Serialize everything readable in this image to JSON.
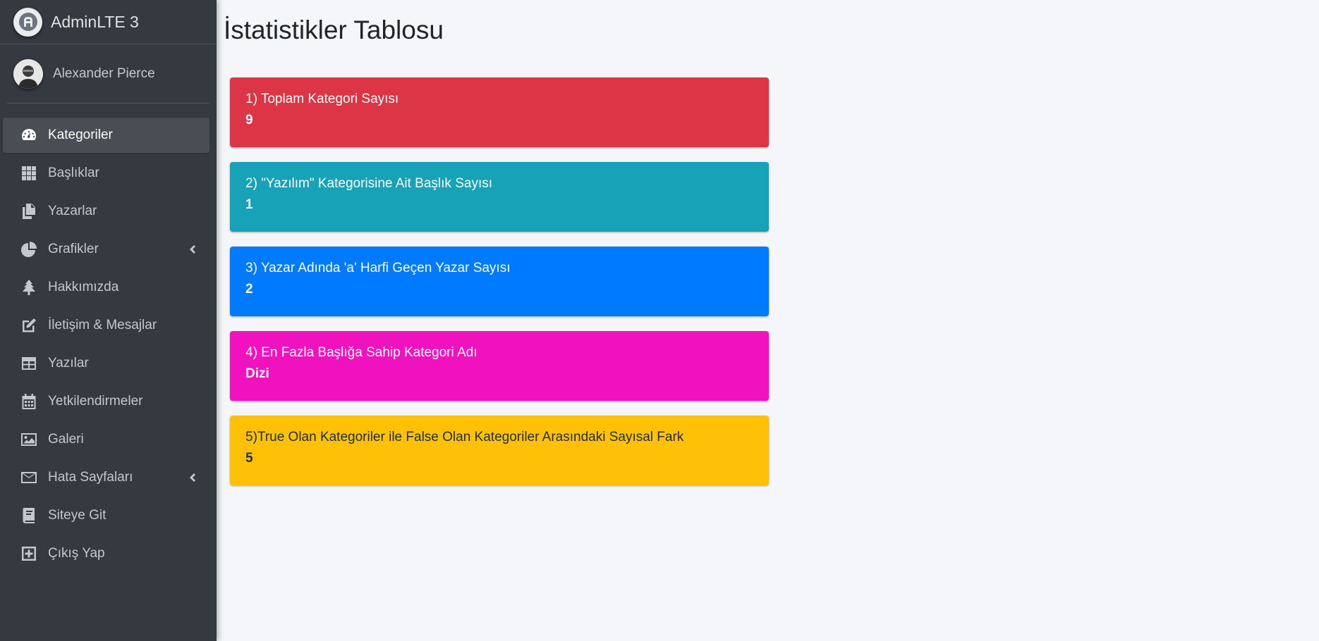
{
  "brand": {
    "title": "AdminLTE 3"
  },
  "user": {
    "name": "Alexander Pierce"
  },
  "sidebar": {
    "items": [
      {
        "label": "Kategoriler",
        "icon": "tachometer-icon",
        "active": true
      },
      {
        "label": "Başlıklar",
        "icon": "grid-icon"
      },
      {
        "label": "Yazarlar",
        "icon": "copy-icon"
      },
      {
        "label": "Grafikler",
        "icon": "chart-pie-icon",
        "has_arrow": true
      },
      {
        "label": "Hakkımızda",
        "icon": "tree-icon"
      },
      {
        "label": "İletişim & Mesajlar",
        "icon": "edit-icon"
      },
      {
        "label": "Yazılar",
        "icon": "table-icon"
      },
      {
        "label": "Yetkilendirmeler",
        "icon": "calendar-icon"
      },
      {
        "label": "Galeri",
        "icon": "image-icon"
      },
      {
        "label": "Hata Sayfaları",
        "icon": "envelope-icon",
        "has_arrow": true
      },
      {
        "label": "Siteye Git",
        "icon": "book-icon"
      },
      {
        "label": "Çıkış Yap",
        "icon": "plus-square-icon"
      }
    ]
  },
  "main": {
    "title": "İstatistikler Tablosu",
    "stats": [
      {
        "title": "1) Toplam Kategori Sayısı",
        "value": "9",
        "color": "#dc3545"
      },
      {
        "title": "2) \"Yazılım\" Kategorisine Ait Başlık Sayısı",
        "value": "1",
        "color": "#17a2b8"
      },
      {
        "title": "3) Yazar Adında 'a' Harfi Geçen Yazar Sayısı",
        "value": "2",
        "color": "#007bff"
      },
      {
        "title": "4) En Fazla Başlığa Sahip Kategori Adı",
        "value": "Dizi",
        "color": "#f012be"
      },
      {
        "title": "5)True Olan Kategoriler ile False Olan Kategoriler Arasındaki Sayısal Fark",
        "value": "5",
        "color": "#ffc107"
      }
    ]
  }
}
